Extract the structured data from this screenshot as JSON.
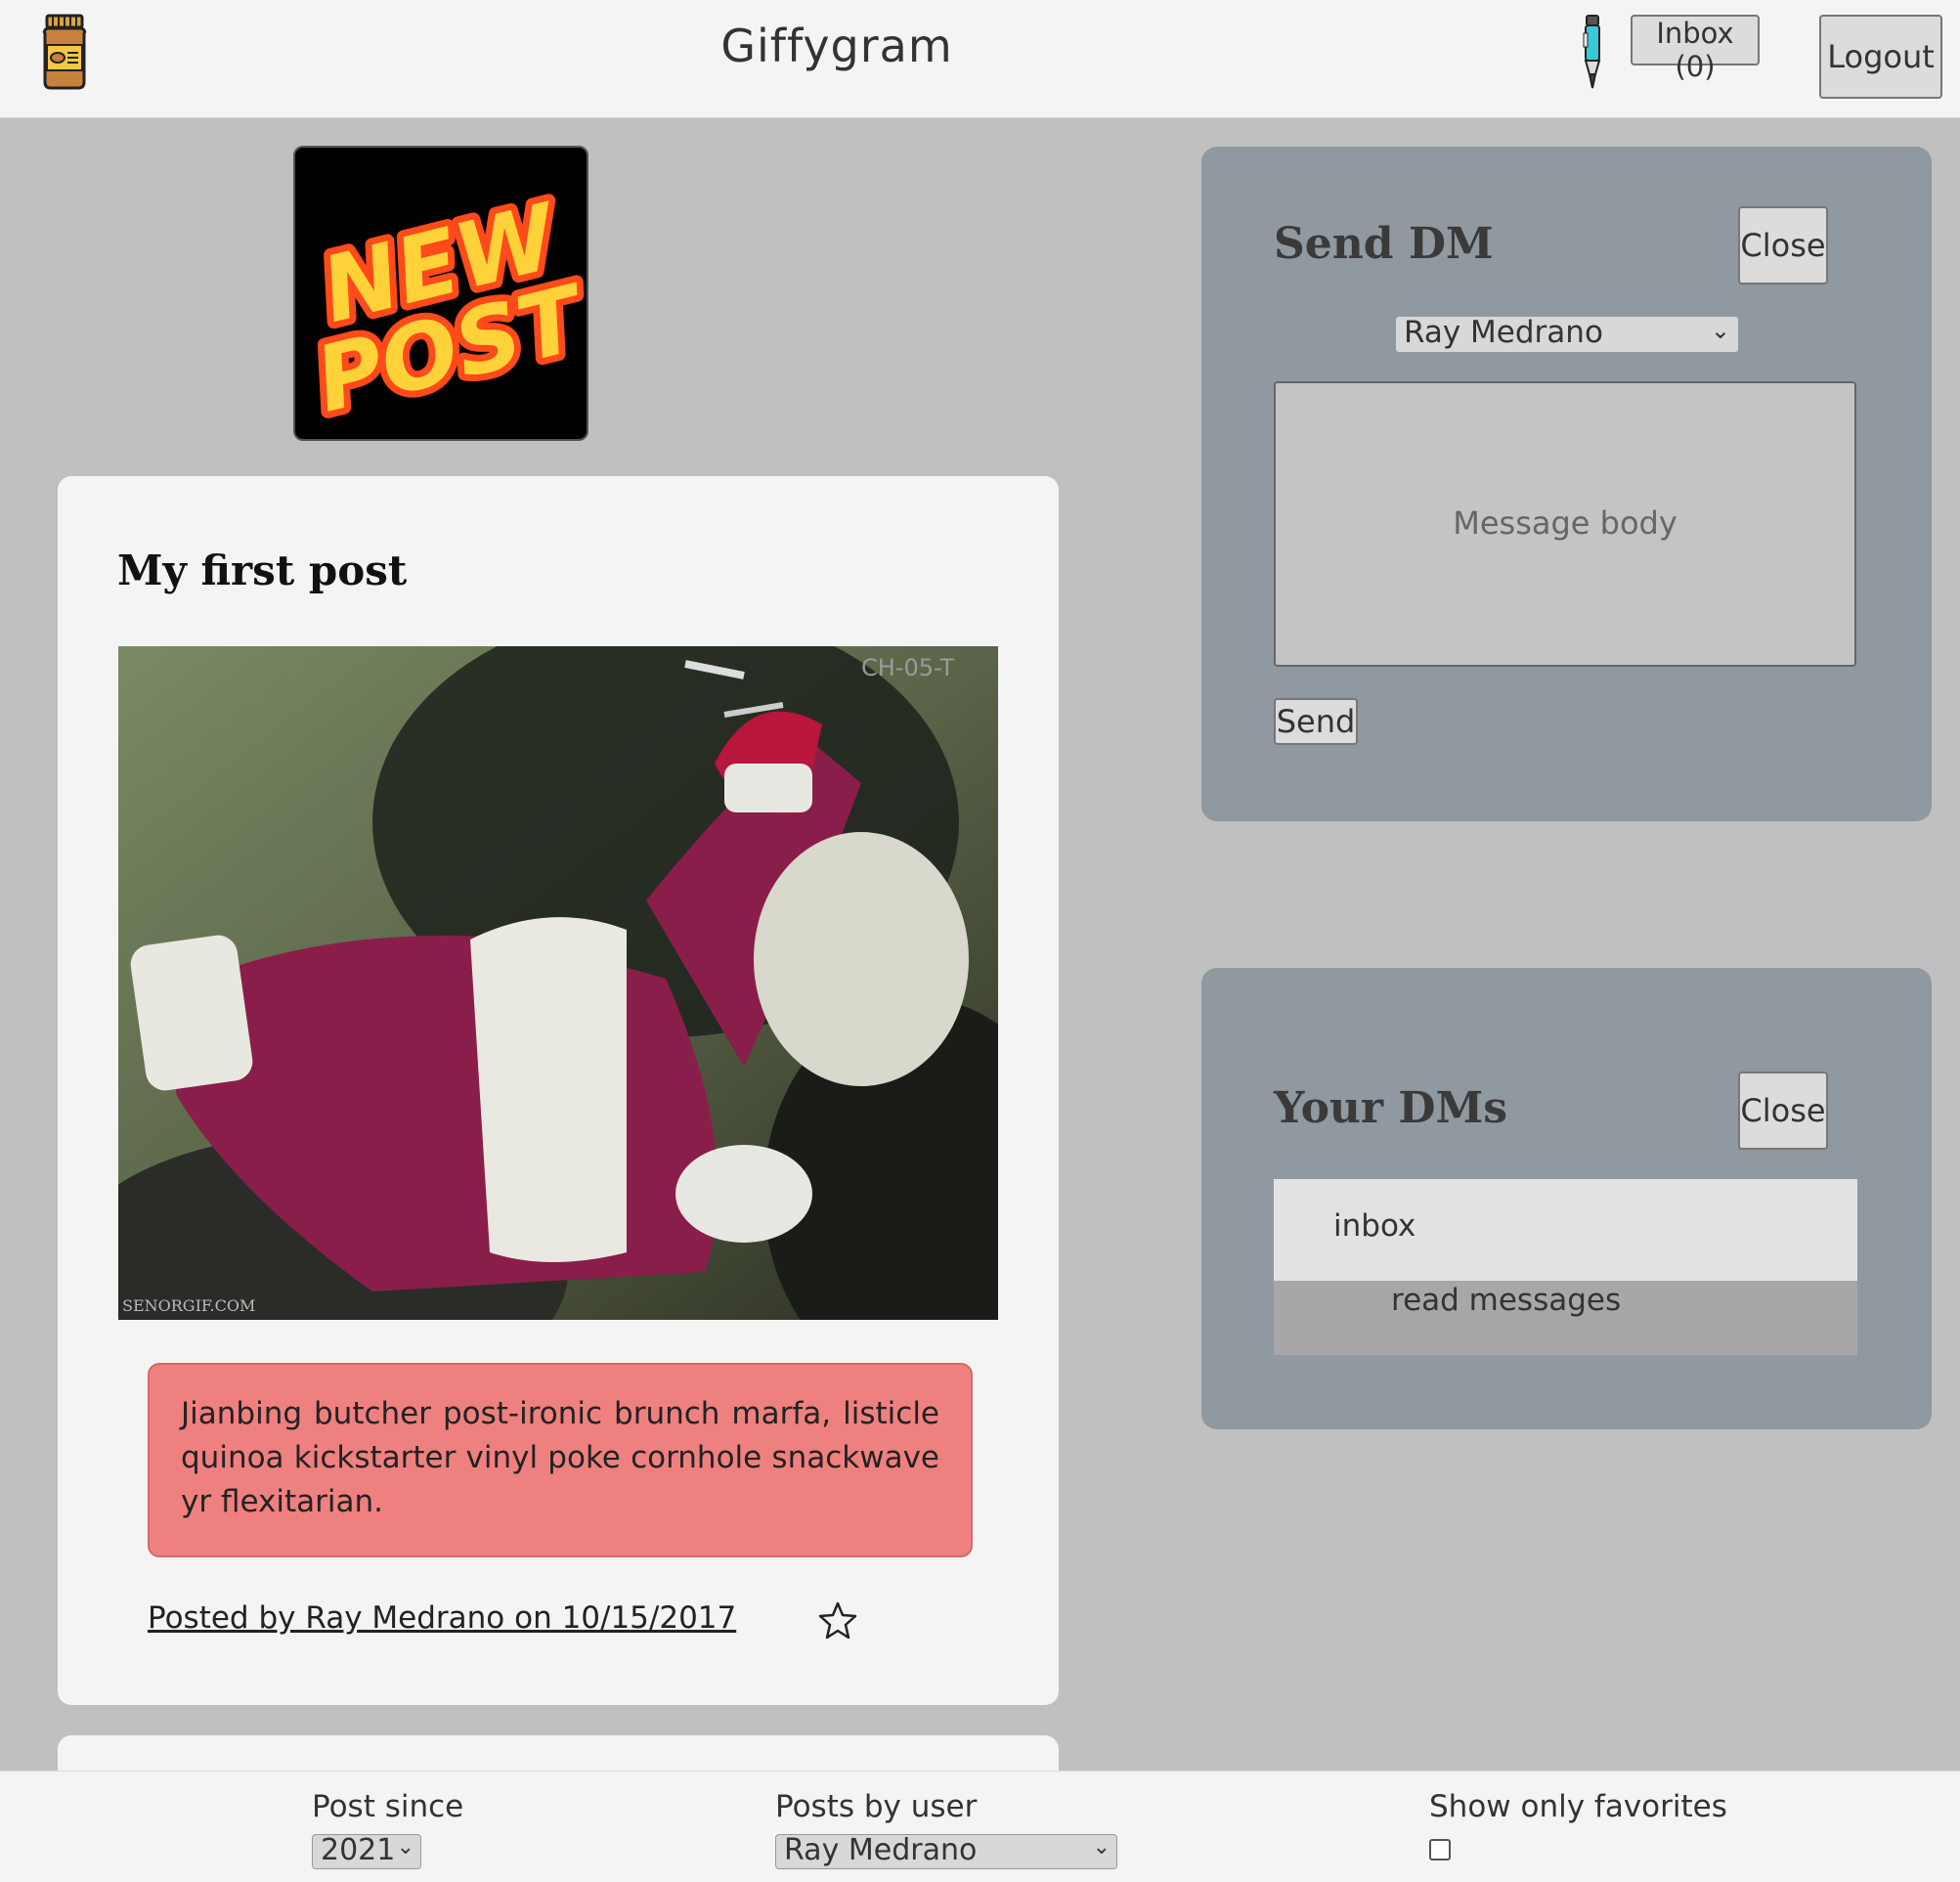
{
  "header": {
    "title": "Giffygram",
    "inbox_label": "Inbox (0)",
    "logout_label": "Logout"
  },
  "new_post": {
    "line1": "NEW",
    "line2": "POST"
  },
  "post": {
    "title": "My first post",
    "image_watermark_top": "CH-05-T",
    "image_watermark_bottom": "SENORGIF.COM",
    "body": "Jianbing butcher post-ironic brunch marfa, listicle quinoa kickstarter vinyl poke cornhole snackwave yr flexitarian.",
    "byline": "Posted by Ray Medrano on 10/15/2017",
    "favorite_icon": "star-outline"
  },
  "send_dm": {
    "title": "Send DM",
    "close_label": "Close",
    "recipient": "Ray Medrano",
    "message_placeholder": "Message body",
    "send_label": "Send"
  },
  "your_dms": {
    "title": "Your DMs",
    "close_label": "Close",
    "tabs": [
      "inbox",
      "read messages"
    ]
  },
  "footer": {
    "post_since_label": "Post since",
    "post_since_value": "2021",
    "posts_by_user_label": "Posts by user",
    "posts_by_user_value": "Ray Medrano",
    "favorites_label": "Show only favorites",
    "favorites_checked": false
  },
  "colors": {
    "page_bg": "#c0c0c0",
    "panel_bg": "#8f999f",
    "post_body_bg": "#ef8080",
    "new_post_fill": "#ff6a1a"
  }
}
